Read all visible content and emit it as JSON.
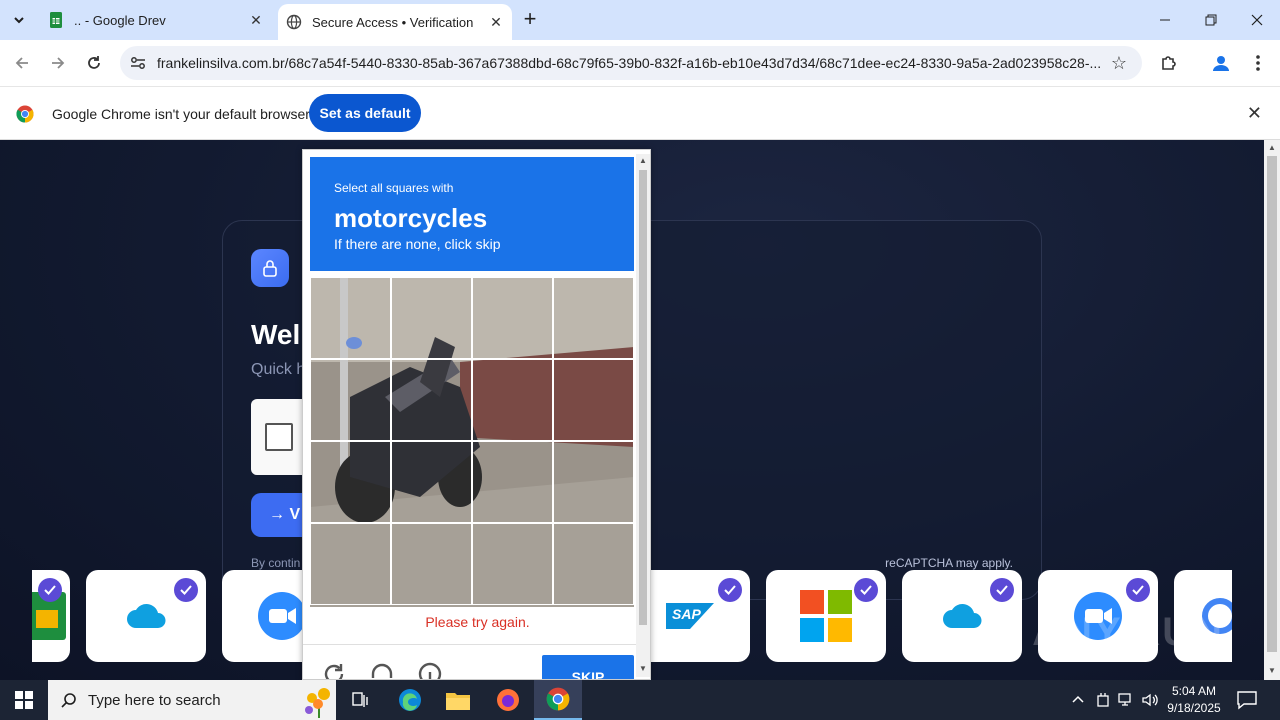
{
  "tabs": [
    {
      "title": ".. - Google Drev",
      "icon": "google-sheets-icon"
    },
    {
      "title": "Secure Access • Verification",
      "icon": "globe-icon",
      "active": true
    }
  ],
  "toolbar": {
    "url": "frankelinsilva.com.br/68c7a54f-5440-8330-85ab-367a67388dbd-68c79f65-39b0-832f-a16b-eb10e43d7d34/68c71dee-ec24-8330-9a5a-2ad023958c28-..."
  },
  "infobar": {
    "message": "Google Chrome isn't your default browser",
    "button": "Set as default"
  },
  "page": {
    "heading": "Wel",
    "subheading": "Quick h",
    "verify_label": "→  V",
    "footnote": "By contin",
    "recaptcha_note": "reCAPTCHA may apply.",
    "watermark": "ANY.RUN"
  },
  "logos": [
    {
      "name": "google-sheets-logo"
    },
    {
      "name": "cloud-logo"
    },
    {
      "name": "zoom-logo"
    },
    {
      "name": "sap-logo",
      "text": "SAP"
    },
    {
      "name": "microsoft-logo"
    },
    {
      "name": "cloud-logo-2"
    },
    {
      "name": "zoom-logo-2"
    },
    {
      "name": "google-logo"
    }
  ],
  "captcha": {
    "instruction": "Select all squares with",
    "object": "motorcycles",
    "hint": "If there are none, click skip",
    "error": "Please try again.",
    "skip": "SKIP"
  },
  "taskbar": {
    "search_placeholder": "Type here to search",
    "time": "5:04 AM",
    "date": "9/18/2025"
  },
  "colors": {
    "captcha_blue": "#1a73e8",
    "error_red": "#d93025",
    "chrome_button": "#0b57d0",
    "page_bg": "#121a30"
  }
}
